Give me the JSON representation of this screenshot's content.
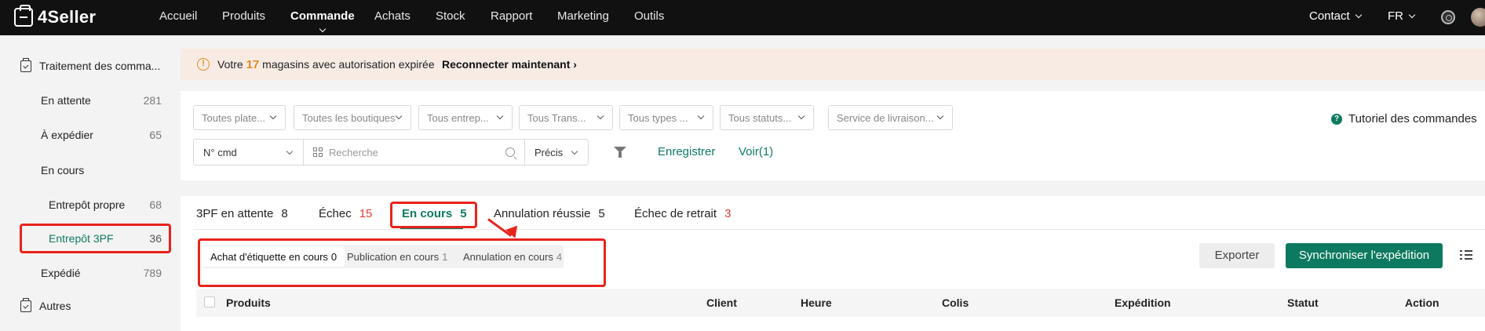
{
  "app": {
    "logo_text": "4Seller"
  },
  "nav": {
    "items": [
      "Accueil",
      "Produits",
      "Commande",
      "Achats",
      "Stock",
      "Rapport",
      "Marketing",
      "Outils"
    ],
    "active": "Commande",
    "contact": "Contact",
    "lang": "FR"
  },
  "sidebar": {
    "section1_title": "Traitement des comma...",
    "items": [
      {
        "label": "En attente",
        "count": "281"
      },
      {
        "label": "À expédier",
        "count": "65"
      },
      {
        "label": "En cours",
        "count": ""
      },
      {
        "label": "Entrepôt propre",
        "count": "68"
      },
      {
        "label": "Entrepôt 3PF",
        "count": "36"
      },
      {
        "label": "Expédié",
        "count": "789"
      }
    ],
    "section2_title": "Autres"
  },
  "banner": {
    "prefix": "Votre",
    "count": "17",
    "suffix": "magasins avec autorisation expirée",
    "link": "Reconnecter maintenant"
  },
  "filters": {
    "dropdowns": [
      "Toutes plate...",
      "Toutes les boutiques",
      "Tous entrep...",
      "Tous Trans...",
      "Tous types ...",
      "Tous statuts...",
      "Service de livraison..."
    ],
    "tutorial": "Tutoriel des commandes",
    "order_field": "N° cmd",
    "search_placeholder": "Recherche",
    "match_mode": "Précis",
    "save": "Enregistrer",
    "view": "Voir(1)"
  },
  "tabs": [
    {
      "label": "3PF en attente",
      "count": "8"
    },
    {
      "label": "Échec",
      "count": "15"
    },
    {
      "label": "En cours",
      "count": "5"
    },
    {
      "label": "Annulation réussie",
      "count": "5"
    },
    {
      "label": "Échec de retrait",
      "count": "3"
    }
  ],
  "subtabs": [
    {
      "label": "Achat d'étiquette en cours",
      "count": "0"
    },
    {
      "label": "Publication en cours",
      "count": "1"
    },
    {
      "label": "Annulation en cours",
      "count": "4"
    }
  ],
  "actions": {
    "export": "Exporter",
    "sync": "Synchroniser l'expédition"
  },
  "table": {
    "headers": [
      "Produits",
      "Client",
      "Heure",
      "Colis",
      "Expédition",
      "Statut",
      "Action"
    ]
  },
  "colors": {
    "accent": "#0d7a5f",
    "warning": "#e58a1f",
    "danger": "#e23b2e",
    "annotation": "#e8231c"
  }
}
